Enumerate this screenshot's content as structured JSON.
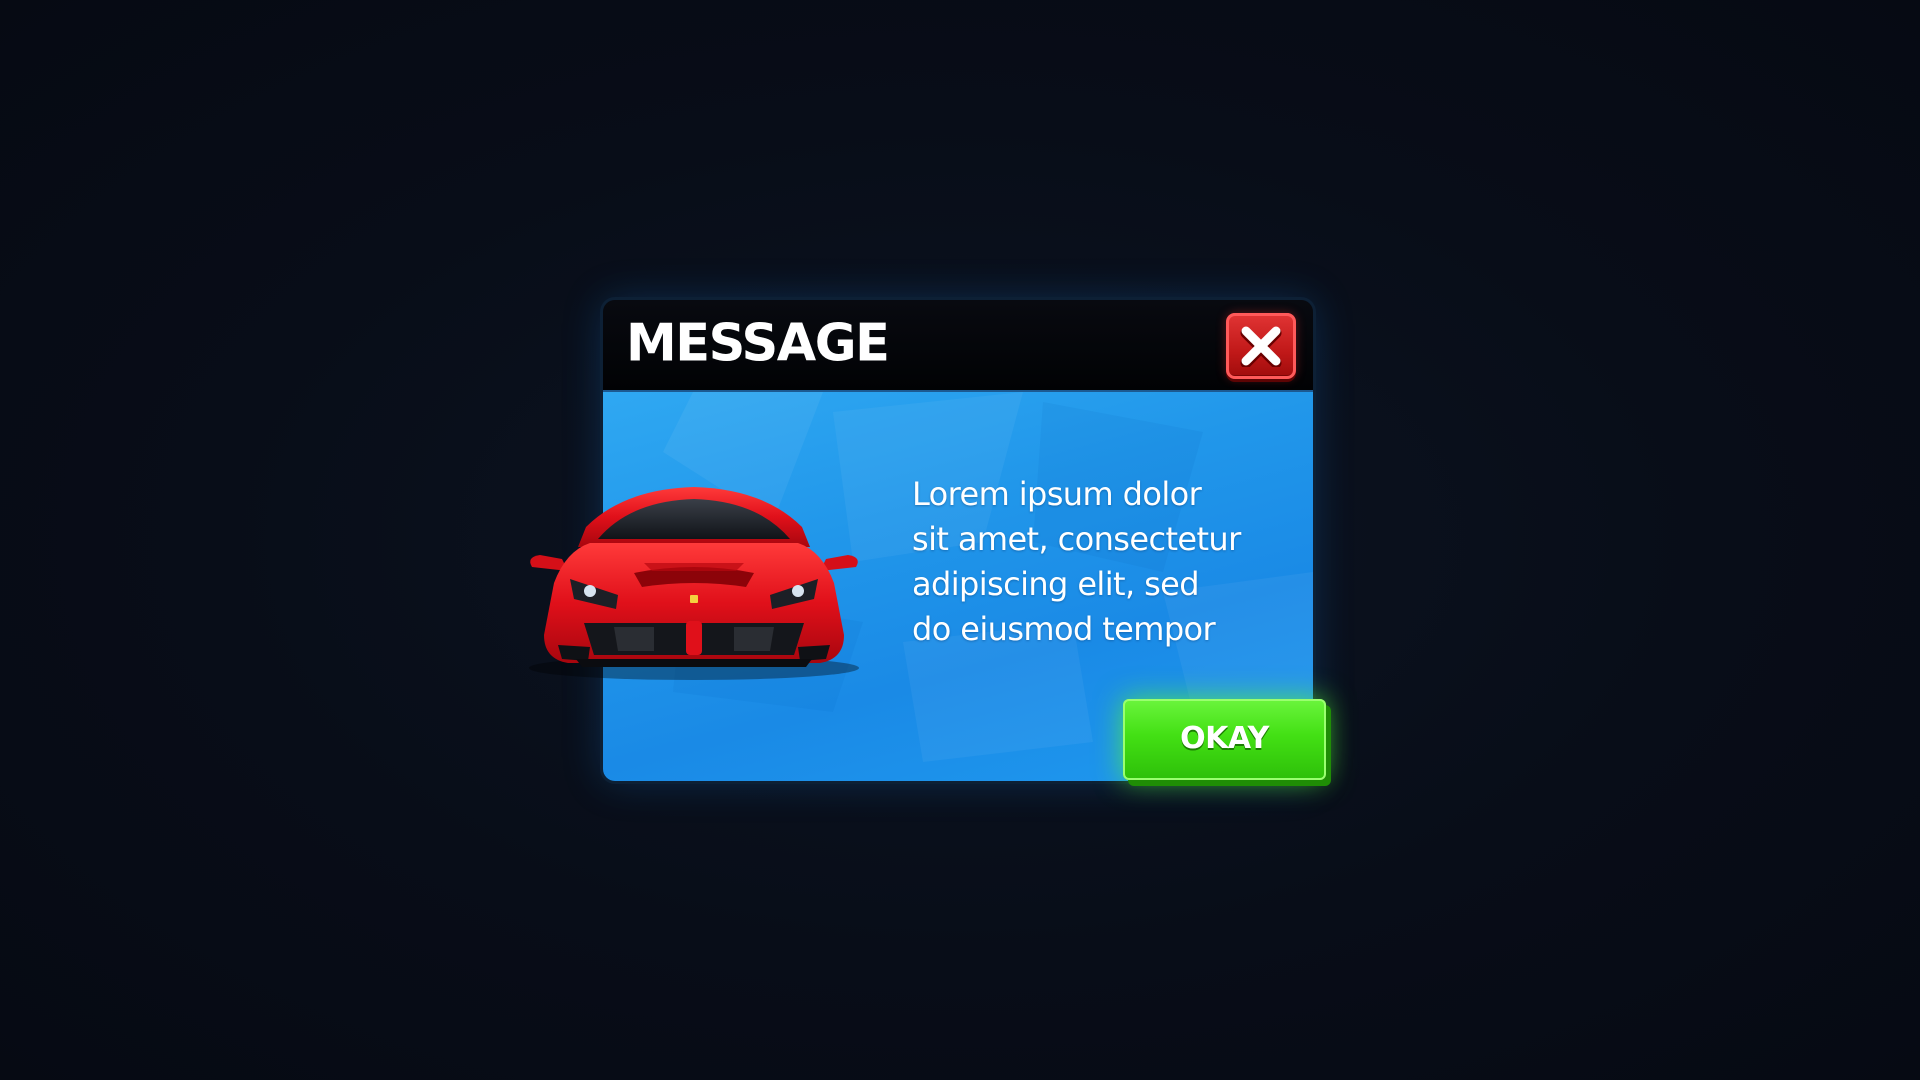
{
  "dialog": {
    "title": "MESSAGE",
    "message_lines": [
      "Lorem ipsum dolor",
      "sit amet, consectetur",
      "adipiscing elit, sed",
      "do eiusmod tempor"
    ],
    "close_icon": "close-x-icon",
    "okay_label": "OKAY",
    "image": "red-sports-car"
  },
  "colors": {
    "background": "#070c16",
    "header": "#030408",
    "body_blue": "#2197ea",
    "close_red": "#d42828",
    "okay_green": "#43e014"
  }
}
